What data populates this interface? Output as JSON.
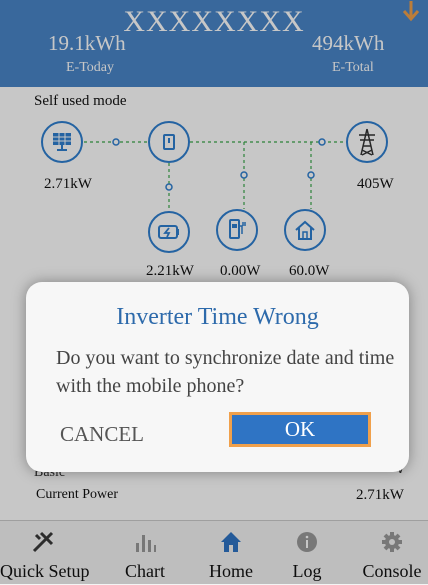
{
  "header": {
    "title": "XXXXXXXX",
    "e_today_value": "19.1kWh",
    "e_today_label": "E-Today",
    "e_total_value": "494kWh",
    "e_total_label": "E-Total"
  },
  "diagram": {
    "mode_label": "Self used mode",
    "pv_power": "2.71kW",
    "grid_power": "405W",
    "battery_power": "2.21kW",
    "ev_power": "0.00W",
    "home_power": "60.0W"
  },
  "dialog": {
    "title": "Inverter Time Wrong",
    "message": "Do you want to synchronize date and time with the mobile phone?",
    "cancel_label": "CANCEL",
    "ok_label": "OK"
  },
  "info": {
    "basic_label": "Basic",
    "current_power_label": "Current Power",
    "current_power_value": "2.71kW"
  },
  "nav": {
    "items": [
      {
        "label": "Quick Setup",
        "icon": "tools-icon"
      },
      {
        "label": "Chart",
        "icon": "bar-chart-icon"
      },
      {
        "label": "Home",
        "icon": "home-icon"
      },
      {
        "label": "Log",
        "icon": "info-icon"
      },
      {
        "label": "Console",
        "icon": "gear-icon"
      }
    ]
  },
  "colors": {
    "header_bg": "#4a86c8",
    "accent": "#2f7fd0",
    "ok_border": "#f0a04b",
    "flow_line": "#3aa84a"
  }
}
